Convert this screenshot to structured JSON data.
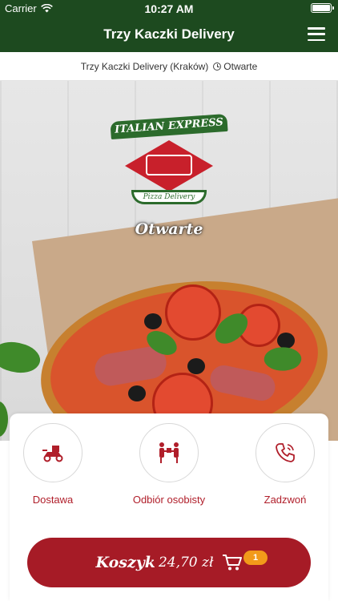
{
  "status_bar": {
    "carrier": "Carrier",
    "time": "10:27 AM"
  },
  "nav": {
    "title": "Trzy Kaczki Delivery"
  },
  "sub_bar": {
    "restaurant": "Trzy Kaczki Delivery (Kraków)",
    "status": "Otwarte"
  },
  "hero": {
    "logo_banner": "ITALIAN EXPRESS",
    "logo_ribbon": "Pizza Delivery",
    "open_text": "Otwarte"
  },
  "actions": {
    "delivery": {
      "label": "Dostawa",
      "icon": "scooter-icon"
    },
    "pickup": {
      "label": "Odbiór osobisty",
      "icon": "handover-icon"
    },
    "call": {
      "label": "Zadzwoń",
      "icon": "phone-icon"
    }
  },
  "cart": {
    "label": "Koszyk",
    "total": "24,70 zł",
    "count": "1",
    "icon": "cart-icon"
  },
  "colors": {
    "header": "#1d4a1f",
    "accent": "#a61b26",
    "badge": "#f29a1a"
  }
}
